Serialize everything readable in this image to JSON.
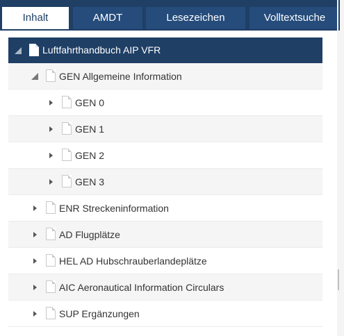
{
  "tabs": [
    {
      "label": "Inhalt",
      "active": true
    },
    {
      "label": "AMDT",
      "active": false
    },
    {
      "label": "Lesezeichen",
      "active": false
    },
    {
      "label": "Volltextsuche",
      "active": false
    }
  ],
  "tree": {
    "root": {
      "label": "Luftfahrthandbuch AIP VFR",
      "expanded": true
    },
    "gen": {
      "label": "GEN Allgemeine Information",
      "expanded": true
    },
    "gen_children": [
      {
        "label": "GEN 0",
        "expanded": false
      },
      {
        "label": "GEN 1",
        "expanded": false
      },
      {
        "label": "GEN 2",
        "expanded": false
      },
      {
        "label": "GEN 3",
        "expanded": false
      }
    ],
    "sections": [
      {
        "label": "ENR Streckeninformation",
        "expanded": false
      },
      {
        "label": "AD Flugplätze",
        "expanded": false
      },
      {
        "label": "HEL AD Hubschrauberlandeplätze",
        "expanded": false
      },
      {
        "label": "AIC Aeronautical Information Circulars",
        "expanded": false
      },
      {
        "label": "SUP Ergänzungen",
        "expanded": false
      }
    ]
  },
  "colors": {
    "navy": "#1f3f65",
    "tab_inactive": "#254c7b",
    "row_alt": "#f5f5f5"
  },
  "icons": {
    "document": "document-icon",
    "expand": "triangle-right-icon",
    "collapse": "triangle-down-icon"
  }
}
